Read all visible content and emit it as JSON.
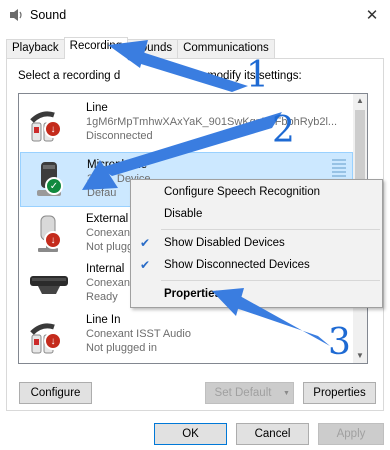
{
  "window": {
    "title": "Sound",
    "close_glyph": "✕"
  },
  "tabs": [
    {
      "label": "Playback",
      "active": false
    },
    {
      "label": "Recording",
      "active": true
    },
    {
      "label": "Sounds",
      "active": false
    },
    {
      "label": "Communications",
      "active": false
    }
  ],
  "instruction": "Select a recording d",
  "instruction_tail": "to modify its settings:",
  "devices": [
    {
      "name": "Line",
      "sub": "1gM6rMpTmhwXAxYaK_901SwKgrARFbbhRyb2l...",
      "status": "Disconnected",
      "icon": "line-in-jack-icon",
      "badge": "red"
    },
    {
      "name": "Microphone",
      "sub": "3- I",
      "sub_tail": "Device",
      "status": "Defau",
      "icon": "microphone-icon",
      "badge": "green"
    },
    {
      "name": "External",
      "sub": "Conexan",
      "status": "Not plugg",
      "icon": "external-mic-icon",
      "badge": "red"
    },
    {
      "name": "Internal",
      "sub": "Conexan",
      "status": "Ready",
      "icon": "internal-mic-array-icon",
      "badge": "none"
    },
    {
      "name": "Line In",
      "sub": "Conexant ISST Audio",
      "status": "Not plugged in",
      "icon": "line-in-jack-icon",
      "badge": "red"
    }
  ],
  "context_menu": {
    "items": [
      {
        "label": "Configure Speech Recognition",
        "checked": false,
        "bold": false
      },
      {
        "label": "Disable",
        "checked": false,
        "bold": false
      },
      {
        "label": "Show Disabled Devices",
        "checked": true,
        "bold": false
      },
      {
        "label": "Show Disconnected Devices",
        "checked": true,
        "bold": false
      },
      {
        "label": "Properties",
        "checked": false,
        "bold": true
      }
    ]
  },
  "buttons": {
    "configure": "Configure",
    "set_default": "Set Default",
    "properties": "Properties",
    "ok": "OK",
    "cancel": "Cancel",
    "apply": "Apply"
  },
  "annotations": [
    "1",
    "2",
    "3"
  ],
  "colors": {
    "annotation_blue": "#1e6ad3",
    "selection": "#cce8ff",
    "check": "#2a6cc7"
  }
}
